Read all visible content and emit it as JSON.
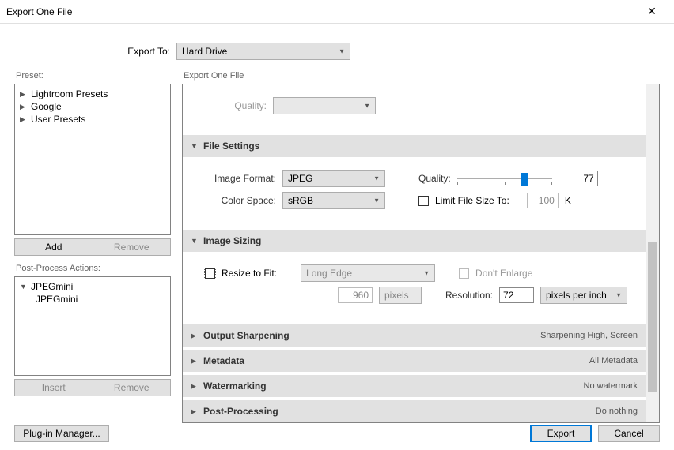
{
  "window": {
    "title": "Export One File"
  },
  "exportTo": {
    "label": "Export To:",
    "value": "Hard Drive"
  },
  "preset": {
    "label": "Preset:",
    "items": [
      "Lightroom Presets",
      "Google",
      "User Presets"
    ],
    "add": "Add",
    "remove": "Remove"
  },
  "postProcess": {
    "label": "Post-Process Actions:",
    "group": "JPEGmini",
    "child": "JPEGmini",
    "insert": "Insert",
    "remove": "Remove"
  },
  "rightHeader": "Export One File",
  "topQuality": {
    "label": "Quality:"
  },
  "fileSettings": {
    "title": "File Settings",
    "imageFormat": {
      "label": "Image Format:",
      "value": "JPEG"
    },
    "quality": {
      "label": "Quality:",
      "value": "77"
    },
    "colorSpace": {
      "label": "Color Space:",
      "value": "sRGB"
    },
    "limitFileSize": {
      "label": "Limit File Size To:",
      "value": "100",
      "unit": "K"
    }
  },
  "imageSizing": {
    "title": "Image Sizing",
    "resize": {
      "label": "Resize to Fit:",
      "value": "Long Edge"
    },
    "dontEnlarge": "Don't Enlarge",
    "dim": {
      "value": "960",
      "unit": "pixels"
    },
    "resolution": {
      "label": "Resolution:",
      "value": "72",
      "unit": "pixels per inch"
    }
  },
  "outputSharpening": {
    "title": "Output Sharpening",
    "summary": "Sharpening High, Screen"
  },
  "metadata": {
    "title": "Metadata",
    "summary": "All Metadata"
  },
  "watermarking": {
    "title": "Watermarking",
    "summary": "No watermark"
  },
  "postProcessing": {
    "title": "Post-Processing",
    "summary": "Do nothing"
  },
  "buttons": {
    "plugin": "Plug-in Manager...",
    "export": "Export",
    "cancel": "Cancel"
  }
}
